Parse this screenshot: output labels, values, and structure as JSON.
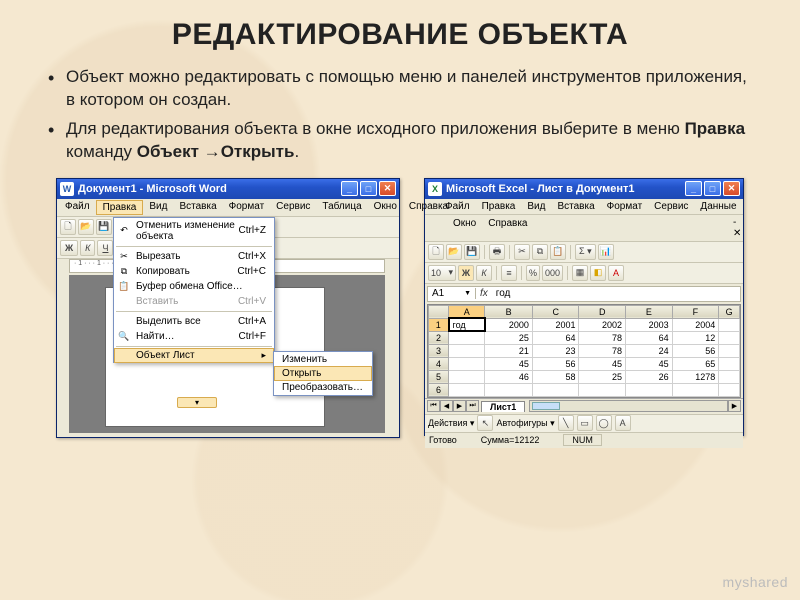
{
  "title": "РЕДАКТИРОВАНИЕ ОБЪЕКТА",
  "bullets": [
    {
      "pre": "Объект можно редактировать с помощью меню и панелей инструментов приложения, в котором он создан."
    },
    {
      "pre": "Для редактирования объекта в окне исходного приложения выберите в меню ",
      "b1": "Правка",
      "mid": " команду ",
      "b2": "Объект",
      "arrow": " →",
      "b3": "Открыть",
      "post": "."
    }
  ],
  "watermark": "myshared",
  "word": {
    "title": "Документ1 - Microsoft Word",
    "appicon": "W",
    "menu": [
      "Файл",
      "Правка",
      "Вид",
      "Вставка",
      "Формат",
      "Сервис",
      "Таблица",
      "Окно",
      "Справка"
    ],
    "ruler": "· 1 · · · 1 · · · 2 · · · 3 · · · 4 · · · 5 · · · 6 ·",
    "expander": "▾",
    "dropdown": [
      {
        "icon": "↶",
        "label": "Отменить изменение объекта",
        "accel": "Ctrl+Z"
      },
      {
        "sep": true
      },
      {
        "icon": "✂",
        "label": "Вырезать",
        "accel": "Ctrl+X"
      },
      {
        "icon": "⧉",
        "label": "Копировать",
        "accel": "Ctrl+C"
      },
      {
        "icon": "📋",
        "label": "Буфер обмена Office…",
        "accel": ""
      },
      {
        "icon": "",
        "label": "Вставить",
        "accel": "Ctrl+V",
        "disabled": true
      },
      {
        "sep": true
      },
      {
        "icon": "",
        "label": "Выделить все",
        "accel": "Ctrl+A"
      },
      {
        "icon": "🔍",
        "label": "Найти…",
        "accel": "Ctrl+F"
      },
      {
        "sep": true
      },
      {
        "icon": "",
        "label": "Объект Лист",
        "accel": "",
        "submenu": true,
        "hl": true
      }
    ],
    "submenu": [
      {
        "label": "Изменить"
      },
      {
        "label": "Открыть",
        "hl": true
      },
      {
        "label": "Преобразовать…"
      }
    ]
  },
  "excel": {
    "title": "Microsoft Excel - Лист в Документ1",
    "appicon": "X",
    "menu1": [
      "Файл",
      "Правка",
      "Вид",
      "Вставка",
      "Формат",
      "Сервис",
      "Данные"
    ],
    "menu2": [
      "Окно",
      "Справка"
    ],
    "close_label": "– ✕",
    "fontsize": "10",
    "namebox": "A1",
    "fx": "fx",
    "formula_val": "год",
    "cols": [
      "A",
      "B",
      "C",
      "D",
      "E",
      "F",
      "G"
    ],
    "rows": [
      "1",
      "2",
      "3",
      "4",
      "5",
      "6"
    ],
    "sheet_tab": "Лист1",
    "draw_label": "Действия ▾",
    "autoshapes": "Автофигуры ▾",
    "status_ready": "Готово",
    "status_sum": "Сумма=12122",
    "status_num": "NUM"
  },
  "chart_data": {
    "type": "table",
    "title": "год",
    "categories": [
      2000,
      2001,
      2002,
      2003,
      2004
    ],
    "series": [
      {
        "name": "row2",
        "values": [
          25,
          64,
          78,
          64,
          12
        ]
      },
      {
        "name": "row3",
        "values": [
          21,
          23,
          78,
          24,
          56
        ]
      },
      {
        "name": "row4",
        "values": [
          45,
          56,
          45,
          45,
          65
        ]
      },
      {
        "name": "row5",
        "values": [
          46,
          58,
          25,
          26,
          1278
        ]
      }
    ]
  }
}
